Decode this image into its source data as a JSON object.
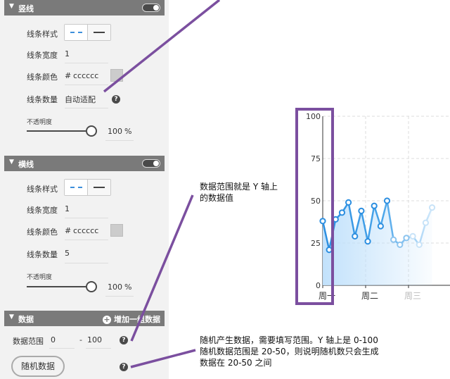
{
  "vertical_section": {
    "title": "竖线",
    "line_style_label": "线条样式",
    "line_width_label": "线条宽度",
    "line_width_value": "1",
    "line_color_label": "线条颜色",
    "hash": "#",
    "line_color_value": "cccccc",
    "line_count_label": "线条数量",
    "line_count_value": "自动适配",
    "opacity_label": "不透明度",
    "opacity_value": "100",
    "percent": "%",
    "enabled": true,
    "opacity_fraction": 1.0
  },
  "horizontal_section": {
    "title": "横线",
    "line_style_label": "线条样式",
    "line_width_label": "线条宽度",
    "line_width_value": "1",
    "line_color_label": "线条颜色",
    "hash": "#",
    "line_color_value": "cccccc",
    "line_count_label": "线条数量",
    "line_count_value": "5",
    "opacity_label": "不透明度",
    "opacity_value": "100",
    "percent": "%",
    "enabled": true,
    "opacity_fraction": 1.0
  },
  "data_section": {
    "title": "数据",
    "add_label": "增加一组数据",
    "range_label": "数据范围",
    "range_min": "0",
    "range_sep": "-",
    "range_max": "100",
    "random_button": "随机数据"
  },
  "help_glyph": "?",
  "annotations": {
    "range_note_line1": "数据范围就是 Y 轴上",
    "range_note_line2": "的数据值",
    "random_note_line1": "随机产生数据，需要填写范围。Y 轴上是 0-100",
    "random_note_line2": "随机数据范围是 20-50，则说明随机数只会生成",
    "random_note_line3": "数据在 20-50 之间",
    "highlight_color": "#7b4f9f"
  },
  "colors": {
    "line_color": "#3d8fdb",
    "header_bg": "#7a7a7a"
  },
  "chart_data": {
    "type": "line",
    "title": "",
    "xlabel": "",
    "ylabel": "",
    "ylim": [
      0,
      100
    ],
    "y_ticks": [
      "100",
      "75",
      "50",
      "25",
      "0"
    ],
    "categories": [
      "周一",
      "周二",
      "周三"
    ],
    "points": [
      {
        "x": 0.0,
        "y": 38
      },
      {
        "x": 0.15,
        "y": 21
      },
      {
        "x": 0.3,
        "y": 39
      },
      {
        "x": 0.45,
        "y": 43
      },
      {
        "x": 0.6,
        "y": 49
      },
      {
        "x": 0.75,
        "y": 29
      },
      {
        "x": 0.9,
        "y": 44
      },
      {
        "x": 1.05,
        "y": 26
      },
      {
        "x": 1.2,
        "y": 47
      },
      {
        "x": 1.35,
        "y": 35
      },
      {
        "x": 1.5,
        "y": 50
      },
      {
        "x": 1.65,
        "y": 27
      },
      {
        "x": 1.8,
        "y": 24
      },
      {
        "x": 1.95,
        "y": 28
      },
      {
        "x": 2.1,
        "y": 29
      },
      {
        "x": 2.25,
        "y": 24
      },
      {
        "x": 2.4,
        "y": 37
      },
      {
        "x": 2.55,
        "y": 46
      }
    ]
  }
}
